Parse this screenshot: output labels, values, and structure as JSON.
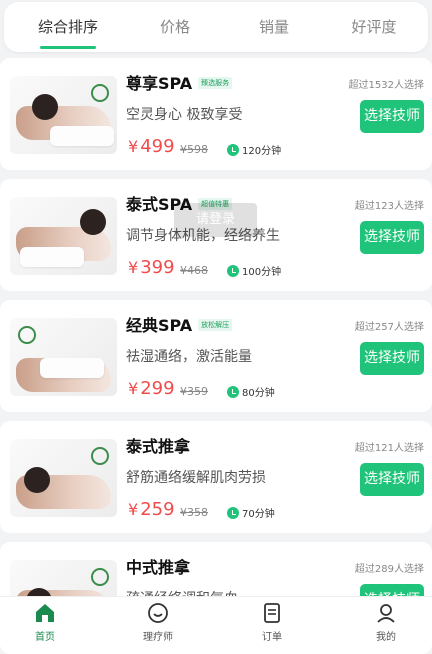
{
  "tabs": [
    {
      "label": "综合排序",
      "active": true
    },
    {
      "label": "价格",
      "active": false
    },
    {
      "label": "销量",
      "active": false
    },
    {
      "label": "好评度",
      "active": false
    }
  ],
  "services": [
    {
      "title": "尊享SPA",
      "tag": "臻选服务",
      "desc": "空灵身心 极致享受",
      "price": "499",
      "original": "¥598",
      "duration": "120分钟",
      "count": "超过1532人选择",
      "button": "选择技师"
    },
    {
      "title": "泰式SPA",
      "tag": "超值特惠",
      "desc": "调节身体机能，经络养生",
      "price": "399",
      "original": "¥468",
      "duration": "100分钟",
      "count": "超过123人选择",
      "button": "选择技师"
    },
    {
      "title": "经典SPA",
      "tag": "放松解压",
      "desc": "祛湿通络，激活能量",
      "price": "299",
      "original": "¥359",
      "duration": "80分钟",
      "count": "超过257人选择",
      "button": "选择技师"
    },
    {
      "title": "泰式推拿",
      "tag": "",
      "desc": "舒筋通络缓解肌肉劳损",
      "price": "259",
      "original": "¥358",
      "duration": "70分钟",
      "count": "超过121人选择",
      "button": "选择技师"
    },
    {
      "title": "中式推拿",
      "tag": "",
      "desc": "疏通经络调和气血",
      "price": "",
      "original": "",
      "duration": "",
      "count": "超过289人选择",
      "button": "选择技师"
    }
  ],
  "currency": "¥",
  "toast": "请登录",
  "nav": [
    {
      "label": "首页",
      "icon": "home-icon",
      "active": true
    },
    {
      "label": "理疗师",
      "icon": "therapist-icon",
      "active": false
    },
    {
      "label": "订单",
      "icon": "order-icon",
      "active": false
    },
    {
      "label": "我的",
      "icon": "profile-icon",
      "active": false
    }
  ],
  "colors": {
    "accent": "#1fc47a",
    "price": "#f24b4b"
  }
}
